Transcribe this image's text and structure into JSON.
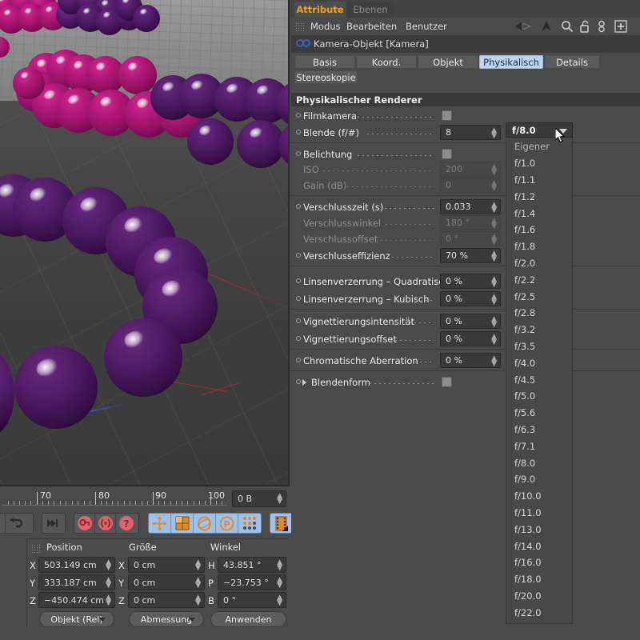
{
  "app": {
    "manager_tabs": [
      {
        "label": "Attribute",
        "active": true
      },
      {
        "label": "Ebenen",
        "active": false
      }
    ],
    "menu": [
      "Modus",
      "Bearbeiten",
      "Benutzer"
    ],
    "header_icons": [
      "back-arrow-icon",
      "forward-arrow-icon",
      "up-arrow-icon",
      "search-icon",
      "lock-open-icon",
      "link-icon",
      "plus-box-icon"
    ]
  },
  "object": {
    "icon": "camera-icon",
    "title": "Kamera-Objekt [Kamera]"
  },
  "property_tabs": [
    {
      "label": "Basis",
      "selected": false
    },
    {
      "label": "Koord.",
      "selected": false
    },
    {
      "label": "Objekt",
      "selected": false
    },
    {
      "label": "Physikalisch",
      "selected": true
    },
    {
      "label": "Details",
      "selected": false
    },
    {
      "label": "Stereoskopie",
      "selected": false
    }
  ],
  "section": {
    "title": "Physikalischer Renderer"
  },
  "attributes": [
    {
      "label": "Filmkamera",
      "type": "checkbox",
      "value": "",
      "enabled": true,
      "group": 1
    },
    {
      "label": "Blende (f/#)",
      "type": "number",
      "value": "8",
      "enabled": true,
      "group": 1
    },
    {
      "label": "Belichtung",
      "type": "checkbox",
      "value": "",
      "enabled": true,
      "group": 2
    },
    {
      "label": "ISO",
      "type": "number",
      "value": "200",
      "enabled": false,
      "group": 2
    },
    {
      "label": "Gain (dB)",
      "type": "number",
      "value": "0",
      "enabled": false,
      "group": 2
    },
    {
      "label": "Verschlusszeit (s)",
      "type": "number",
      "value": "0.033",
      "enabled": true,
      "group": 3
    },
    {
      "label": "Verschlusswinkel",
      "type": "number",
      "value": "180 °",
      "enabled": false,
      "group": 3
    },
    {
      "label": "Verschlussoffset",
      "type": "number",
      "value": "0 °",
      "enabled": false,
      "group": 3
    },
    {
      "label": "Verschlusseffizienz",
      "type": "number",
      "value": "70 %",
      "enabled": true,
      "group": 3
    },
    {
      "label": "Linsenverzerrung – Quadratisch",
      "type": "number",
      "value": "0 %",
      "enabled": true,
      "group": 4
    },
    {
      "label": "Linsenverzerrung – Kubisch",
      "type": "number",
      "value": "0 %",
      "enabled": true,
      "group": 4
    },
    {
      "label": "Vignettierungsintensität",
      "type": "number",
      "value": "0 %",
      "enabled": true,
      "group": 5
    },
    {
      "label": "Vignettierungsoffset",
      "type": "number",
      "value": "0 %",
      "enabled": true,
      "group": 5
    },
    {
      "label": "Chromatische Aberration",
      "type": "number",
      "value": "0 %",
      "enabled": true,
      "group": 6
    },
    {
      "label": "Blendenform",
      "type": "checkbox",
      "value": "",
      "enabled": true,
      "group": 7,
      "expandable": true
    }
  ],
  "dropdown": {
    "name": "aperture-preset-dropdown",
    "selected": "f/8.0",
    "options": [
      "Eigener",
      "f/1.0",
      "f/1.1",
      "f/1.2",
      "f/1.4",
      "f/1.6",
      "f/1.8",
      "f/2.0",
      "f/2.2",
      "f/2.5",
      "f/2.8",
      "f/3.2",
      "f/3.5",
      "f/4.0",
      "f/4.5",
      "f/5.0",
      "f/5.6",
      "f/6.3",
      "f/7.1",
      "f/8.0",
      "f/9.0",
      "f/10.0",
      "f/11.0",
      "f/13.0",
      "f/14.0",
      "f/16.0",
      "f/18.0",
      "f/20.0",
      "f/22.0"
    ]
  },
  "timeline": {
    "ticks": [
      "70",
      "80",
      "90",
      "100"
    ],
    "frame_field_value": "0 B"
  },
  "toolbar": {
    "groups": [
      {
        "icons": [
          "play-icon",
          "loop-icon"
        ],
        "highlighted": false
      },
      {
        "icons": [
          "go-to-end-icon"
        ],
        "highlighted": false
      },
      {
        "icons": [
          "record-key-icon",
          "record-auto-icon",
          "record-question-icon"
        ],
        "highlighted": false
      },
      {
        "icons": [
          "move-tool-icon",
          "scale-tool-icon",
          "rotate-tool-icon",
          "parameter-tool-icon",
          "points-tool-icon"
        ],
        "highlighted": true
      },
      {
        "icons": [
          "timeline-icon"
        ],
        "highlighted": true
      }
    ]
  },
  "coordinates": {
    "headers": [
      "Position",
      "Größe",
      "Winkel"
    ],
    "rows": [
      {
        "pos_axis": "X",
        "pos_value": "503.149 cm",
        "size_axis": "X",
        "size_value": "0 cm",
        "rot_axis": "H",
        "rot_value": "43.851 °"
      },
      {
        "pos_axis": "Y",
        "pos_value": "333.187 cm",
        "size_axis": "Y",
        "size_value": "0 cm",
        "rot_axis": "P",
        "rot_value": "−23.753 °"
      },
      {
        "pos_axis": "Z",
        "pos_value": "−450.474 cm",
        "size_axis": "Z",
        "size_value": "0 cm",
        "rot_axis": "B",
        "rot_value": "0 °"
      }
    ],
    "mode_select": "Objekt (Rel)",
    "size_select": "Abmessung",
    "apply_button": "Anwenden"
  },
  "colors": {
    "accent_orange": "#f2a01e",
    "tab_selected": "#bcd4f0",
    "panel_bg": "#4a4a4a",
    "field_bg": "#3a3a3a",
    "sphere_magenta": "#b3197a",
    "sphere_purple": "#531d68"
  }
}
